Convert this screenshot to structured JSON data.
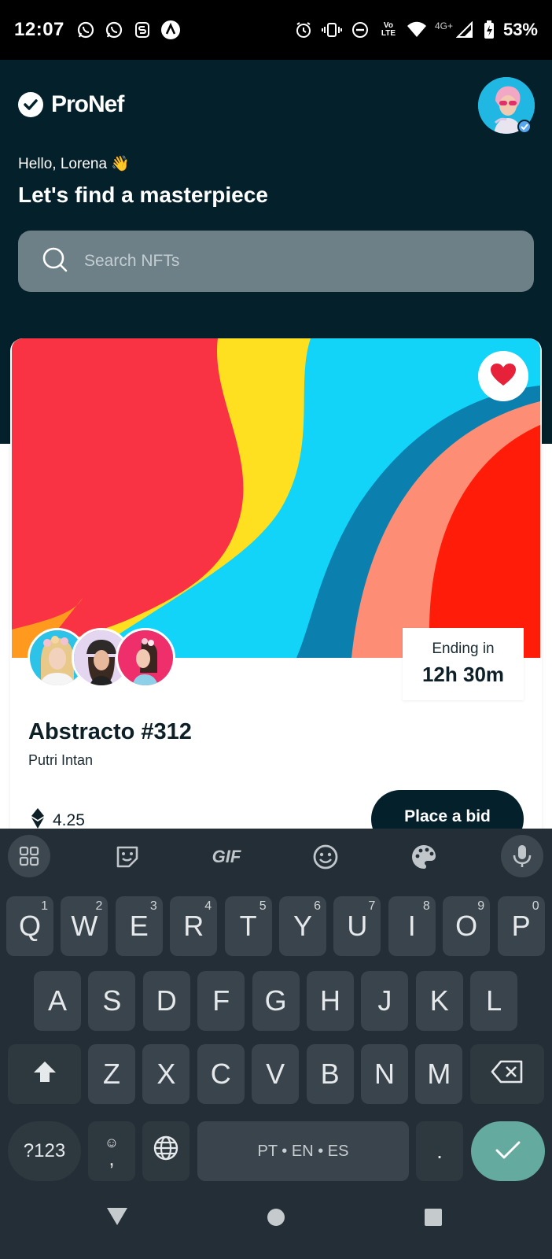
{
  "status": {
    "time": "12:07",
    "battery": "53%",
    "network": "4G+",
    "left_icons": [
      "whatsapp-icon",
      "whatsapp-icon",
      "s-app-icon",
      "a-app-icon"
    ],
    "right_icons": [
      "alarm-icon",
      "vibrate-icon",
      "dnd-icon",
      "volte-icon",
      "wifi-icon",
      "signal-icon",
      "battery-icon"
    ]
  },
  "header": {
    "brand": "ProNef",
    "greeting": "Hello, Lorena 👋",
    "headline": "Let's find a masterpiece",
    "bg_color": "#04202b"
  },
  "search": {
    "placeholder": "Search NFTs"
  },
  "card": {
    "ending_label": "Ending in",
    "ending_value": "12h 30m",
    "title": "Abstracto #312",
    "artist": "Putri Intan",
    "price": "4.25",
    "bid_label": "Place a bid",
    "liked": true
  },
  "keyboard": {
    "row1": [
      {
        "k": "Q",
        "h": "1"
      },
      {
        "k": "W",
        "h": "2"
      },
      {
        "k": "E",
        "h": "3"
      },
      {
        "k": "R",
        "h": "4"
      },
      {
        "k": "T",
        "h": "5"
      },
      {
        "k": "Y",
        "h": "6"
      },
      {
        "k": "U",
        "h": "7"
      },
      {
        "k": "I",
        "h": "8"
      },
      {
        "k": "O",
        "h": "9"
      },
      {
        "k": "P",
        "h": "0"
      }
    ],
    "row2": [
      "A",
      "S",
      "D",
      "F",
      "G",
      "H",
      "J",
      "K",
      "L"
    ],
    "row3": [
      "Z",
      "X",
      "C",
      "V",
      "B",
      "N",
      "M"
    ],
    "symbols_label": "?123",
    "comma_label": ",",
    "space_label": "PT • EN • ES",
    "period_label": ".",
    "gif_label": "GIF"
  }
}
